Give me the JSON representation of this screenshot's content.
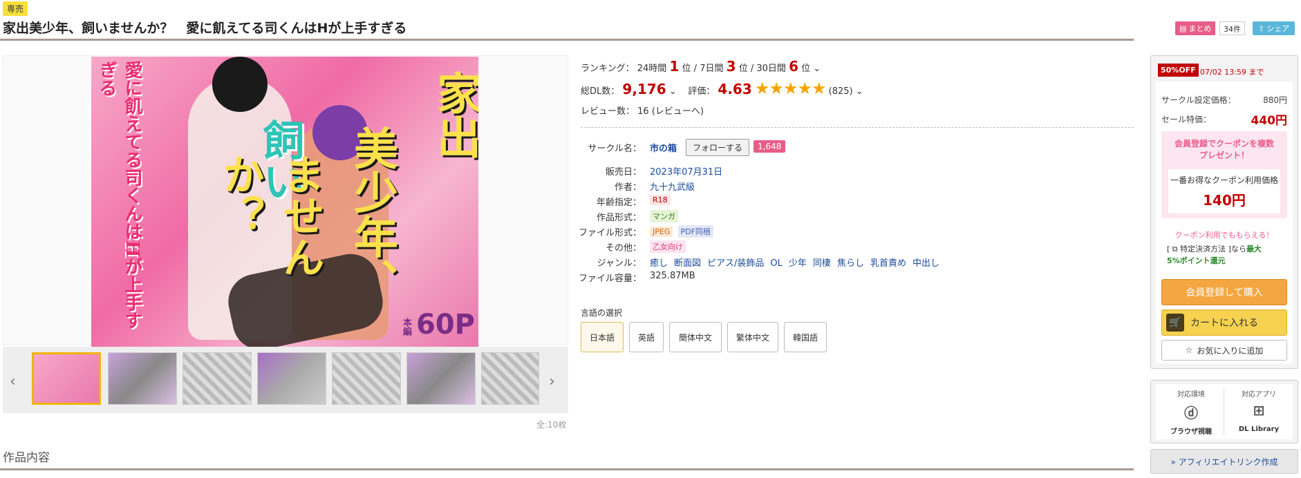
{
  "header": {
    "exclusive_badge": "専売",
    "title": "家出美少年、飼いませんか？　愛に飢えてる司くんはHが上手すぎる",
    "matome_label": "まとめ",
    "matome_count": "34件",
    "share_label": "シェア"
  },
  "cover": {
    "line1": "愛に飢えてる司くんはHが上手すぎる",
    "title_a": "家出",
    "title_b": "美少年、",
    "title_c": "飼い",
    "title_d": "ませんか？",
    "honpen": "本編",
    "pages": "60P"
  },
  "gallery": {
    "prev": "‹",
    "next": "›",
    "total": "全:10枚"
  },
  "ranking": {
    "label": "ランキング：",
    "p24_label": "24時間",
    "p24_value": "1",
    "p7_label": "7日間",
    "p7_value": "3",
    "p30_label": "30日間",
    "p30_value": "6",
    "unit": "位",
    "sep": "/"
  },
  "stats": {
    "dl_label": "総DL数：",
    "dl_value": "9,176",
    "rating_label": "評価：",
    "rating_value": "4.63",
    "rating_count": "(825)",
    "stars": "★★★★★",
    "review_label": "レビュー数：",
    "review_value": "16 (レビューへ)"
  },
  "circle": {
    "label": "サークル名：",
    "name": "市の箱",
    "follow": "フォローする",
    "followers": "1,648"
  },
  "specs": {
    "release_label": "販売日：",
    "release": "2023年07月31日",
    "author_label": "作者：",
    "author": "九十九武級",
    "age_label": "年齢指定：",
    "age": "R18",
    "format_label": "作品形式：",
    "format": "マンガ",
    "file_label": "ファイル形式：",
    "file1": "JPEG",
    "file2": "PDF同梱",
    "other_label": "その他：",
    "other": "乙女向け",
    "genre_label": "ジャンル：",
    "genres": [
      "癒し",
      "断面図",
      "ピアス/装飾品",
      "OL",
      "少年",
      "同棲",
      "焦らし",
      "乳首責め",
      "中出し"
    ],
    "size_label": "ファイル容量：",
    "size": "325.87MB"
  },
  "language": {
    "label": "言語の選択",
    "options": [
      "日本語",
      "英語",
      "簡体中文",
      "繁体中文",
      "韓国語"
    ],
    "selected": "日本語"
  },
  "purchase": {
    "off_badge": "50%OFF",
    "off_until": "07/02 13:59 まで",
    "list_label": "サークル設定価格：",
    "list_price": "880円",
    "sale_label": "セール特価：",
    "sale_price": "440円",
    "coupon_title1": "会員登録でクーポンを複数",
    "coupon_title2": "プレゼント！",
    "coupon_best_label": "一番お得なクーポン利用価格",
    "coupon_best_price": "140円",
    "coupon_note": "クーポン利用でももらえる！",
    "point_note_a": "[ ⧉ 特定決済方法 ]なら",
    "point_note_b": "最大",
    "point_note_c": "5%ポイント還元",
    "buy_label": "会員登録して購入",
    "cart_label": "カートに入れる",
    "fav_label": "お気に入りに追加"
  },
  "env": {
    "env_label": "対応環境",
    "env_name": "ブラウザ視聴",
    "app_label": "対応アプリ",
    "app_name": "DL Library",
    "affiliate": "» アフィリエイトリンク作成"
  },
  "content": {
    "heading": "作品内容"
  },
  "colors": {
    "accent_red": "#c20000",
    "pink": "#e95c8a",
    "star": "#f5a300",
    "link": "#1a4b9c"
  }
}
